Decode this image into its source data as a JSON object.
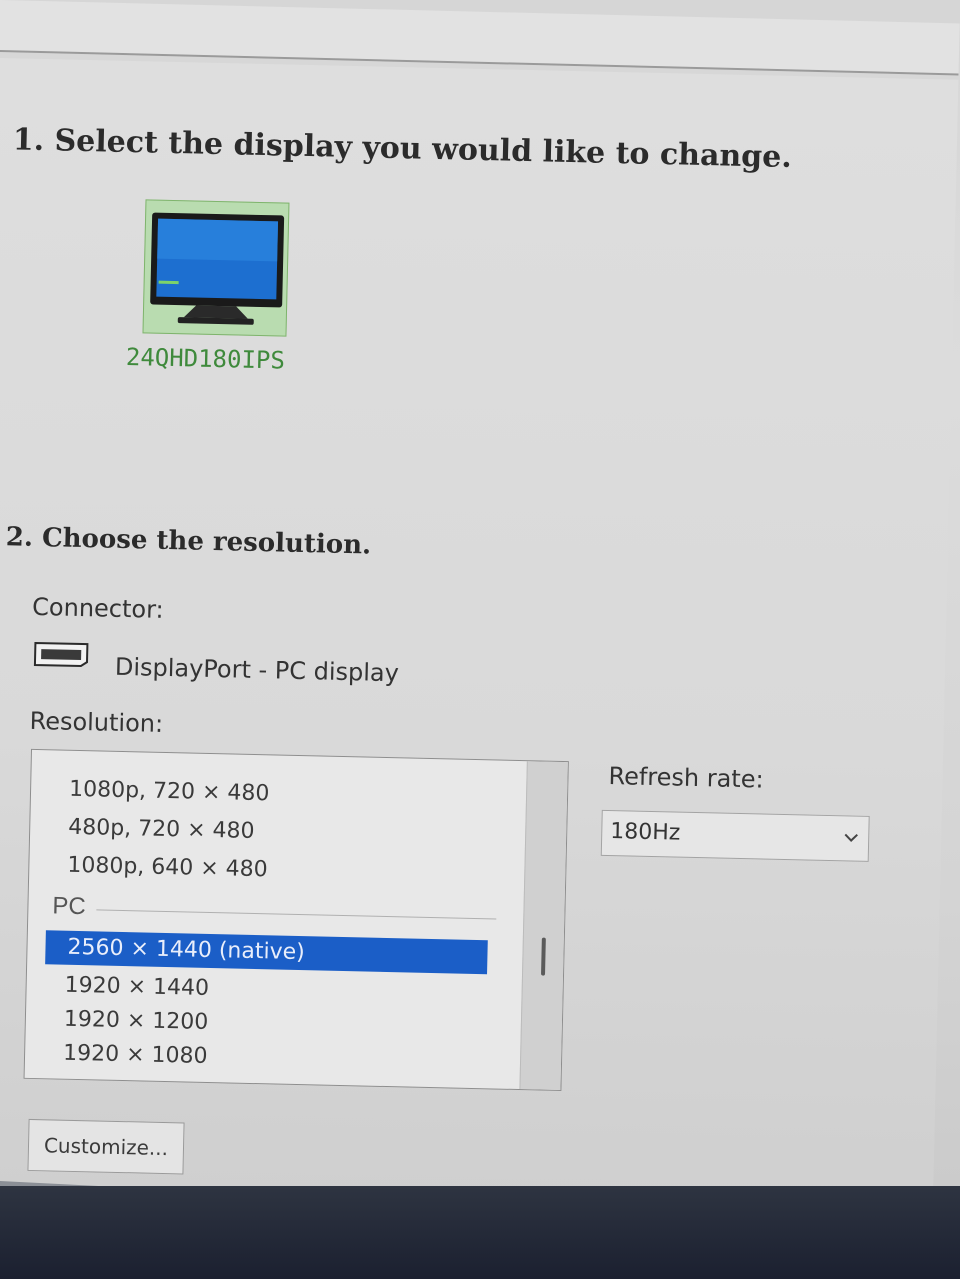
{
  "step1": {
    "title": "1. Select the display you would like to change.",
    "display_name": "24QHD180IPS"
  },
  "step2": {
    "title": "2. Choose the resolution."
  },
  "connector": {
    "label": "Connector:",
    "value": "DisplayPort - PC display",
    "icon": "displayport-icon"
  },
  "resolution": {
    "label": "Resolution:",
    "items_above": [
      "1080p, 720 × 480",
      "480p, 720 × 480",
      "1080p, 640 × 480"
    ],
    "group_label": "PC",
    "pc_items": [
      "2560 × 1440 (native)",
      "1920 × 1440",
      "1920 × 1200",
      "1920 × 1080"
    ],
    "selected": "2560 × 1440 (native)"
  },
  "refresh": {
    "label": "Refresh rate:",
    "value": "180Hz",
    "icon": "chevron-down-icon"
  },
  "buttons": {
    "customize": "Customize..."
  },
  "colors": {
    "selection": "#1b5ec7",
    "display_tile": "#b9dcb0",
    "display_name": "#3f8a3c"
  }
}
